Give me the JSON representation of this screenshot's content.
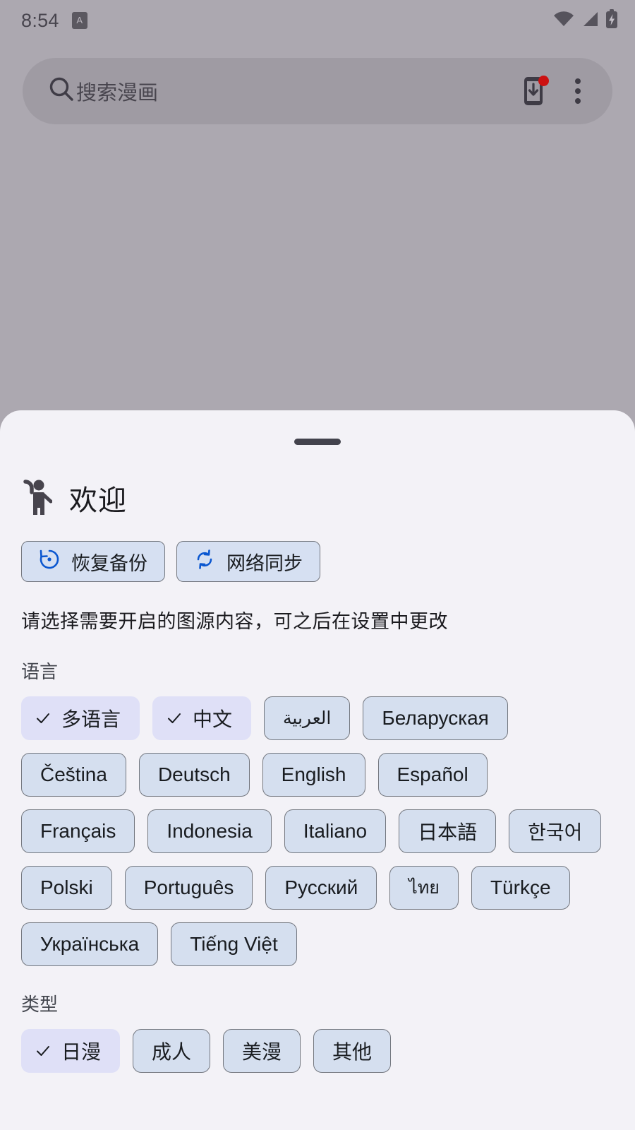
{
  "status_bar": {
    "clock": "8:54",
    "notification_badge": "A",
    "icons": [
      "wifi-icon",
      "cellular-signal-icon",
      "battery-charging-icon"
    ]
  },
  "search": {
    "placeholder": "搜索漫画",
    "search_icon": "search-icon",
    "download_icon": "phone-download-icon",
    "has_download_badge": true,
    "overflow_icon": "more-vertical-icon"
  },
  "sheet": {
    "drag_handle": "drag-handle",
    "welcome_icon": "waving-person-icon",
    "welcome_title": "欢迎",
    "actions": [
      {
        "label": "恢复备份",
        "icon": "restore-backup-icon"
      },
      {
        "label": "网络同步",
        "icon": "sync-icon"
      }
    ],
    "hint": "请选择需要开启的图源内容，可之后在设置中更改",
    "language_section": {
      "label": "语言",
      "chips": [
        {
          "label": "多语言",
          "selected": true
        },
        {
          "label": "中文",
          "selected": true
        },
        {
          "label": "العربية",
          "selected": false,
          "script": "arabic"
        },
        {
          "label": "Беларуская",
          "selected": false
        },
        {
          "label": "Čeština",
          "selected": false
        },
        {
          "label": "Deutsch",
          "selected": false
        },
        {
          "label": "English",
          "selected": false
        },
        {
          "label": "Español",
          "selected": false
        },
        {
          "label": "Français",
          "selected": false
        },
        {
          "label": "Indonesia",
          "selected": false
        },
        {
          "label": "Italiano",
          "selected": false
        },
        {
          "label": "日本語",
          "selected": false
        },
        {
          "label": "한국어",
          "selected": false
        },
        {
          "label": "Polski",
          "selected": false
        },
        {
          "label": "Português",
          "selected": false
        },
        {
          "label": "Русский",
          "selected": false
        },
        {
          "label": "ไทย",
          "selected": false,
          "script": "thai"
        },
        {
          "label": "Türkçe",
          "selected": false
        },
        {
          "label": "Українська",
          "selected": false
        },
        {
          "label": "Tiếng Việt",
          "selected": false
        }
      ]
    },
    "type_section": {
      "label": "类型",
      "chips": [
        {
          "label": "日漫",
          "selected": true
        },
        {
          "label": "成人",
          "selected": false
        },
        {
          "label": "美漫",
          "selected": false
        },
        {
          "label": "其他",
          "selected": false
        }
      ]
    }
  },
  "colors": {
    "backdrop": "#aca8b0",
    "sheet_bg": "#f3f2f7",
    "chip_unselected": "#d5dfef",
    "chip_selected": "#dfe0f7",
    "chip_border": "#73777f",
    "accent": "#0b57d0",
    "badge_red": "#cc1111",
    "text_primary": "#1b1b1f"
  }
}
